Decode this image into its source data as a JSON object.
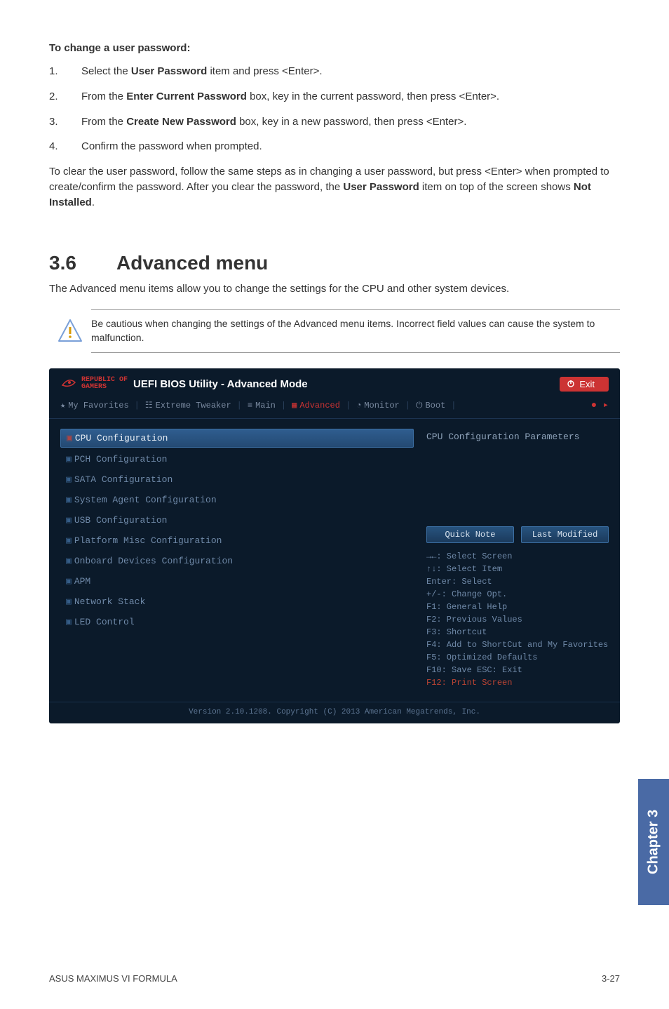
{
  "doc": {
    "heading_change_pw": "To change a user password:",
    "steps": [
      {
        "num": "1.",
        "pre": "Select the ",
        "bold": "User Password",
        "post": " item and press <Enter>."
      },
      {
        "num": "2.",
        "pre": "From the ",
        "bold": "Enter Current Password",
        "post": " box, key in the current password, then press <Enter>."
      },
      {
        "num": "3.",
        "pre": "From the ",
        "bold": "Create New Password",
        "post": " box, key in a new password, then press <Enter>."
      },
      {
        "num": "4.",
        "pre": "Confirm the password when prompted.",
        "bold": "",
        "post": ""
      }
    ],
    "clear_pw_1": "To clear the user password, follow the same steps as in changing a user password, but press <Enter> when prompted to create/confirm the password. After you clear the password, the ",
    "clear_pw_bold1": "User Password",
    "clear_pw_2": " item on top of the screen shows ",
    "clear_pw_bold2": "Not Installed",
    "clear_pw_3": ".",
    "sec_num": "3.6",
    "sec_title": "Advanced menu",
    "sec_intro": "The Advanced menu items allow you to change the settings for the CPU and other system devices.",
    "caution": "Be cautious when changing the settings of the Advanced menu items. Incorrect field values can cause the system to malfunction."
  },
  "bios": {
    "brand_top": "REPUBLIC OF",
    "brand_bottom": "GAMERS",
    "title": "UEFI BIOS Utility - Advanced Mode",
    "exit": "Exit",
    "tabs": {
      "fav": "My Favorites",
      "tweaker": "Extreme Tweaker",
      "main": "Main",
      "advanced": "Advanced",
      "monitor": "Monitor",
      "boot": "Boot"
    },
    "menu": [
      "CPU Configuration",
      "PCH Configuration",
      "SATA Configuration",
      "System Agent Configuration",
      "USB Configuration",
      "Platform Misc Configuration",
      "Onboard Devices Configuration",
      "APM",
      "Network Stack",
      "LED Control"
    ],
    "right_title": "CPU Configuration Parameters",
    "pill_quick": "Quick Note",
    "pill_last": "Last Modified",
    "help": [
      "→←: Select Screen",
      "↑↓: Select Item",
      "Enter: Select",
      "+/-: Change Opt.",
      "F1: General Help",
      "F2: Previous Values",
      "F3: Shortcut",
      "F4: Add to ShortCut and My Favorites",
      "F5: Optimized Defaults",
      "F10: Save  ESC: Exit",
      "F12: Print Screen"
    ],
    "footer": "Version 2.10.1208. Copyright (C) 2013 American Megatrends, Inc."
  },
  "chapter_tab": "Chapter 3",
  "footer_left": "ASUS MAXIMUS VI FORMULA",
  "footer_right": "3-27"
}
